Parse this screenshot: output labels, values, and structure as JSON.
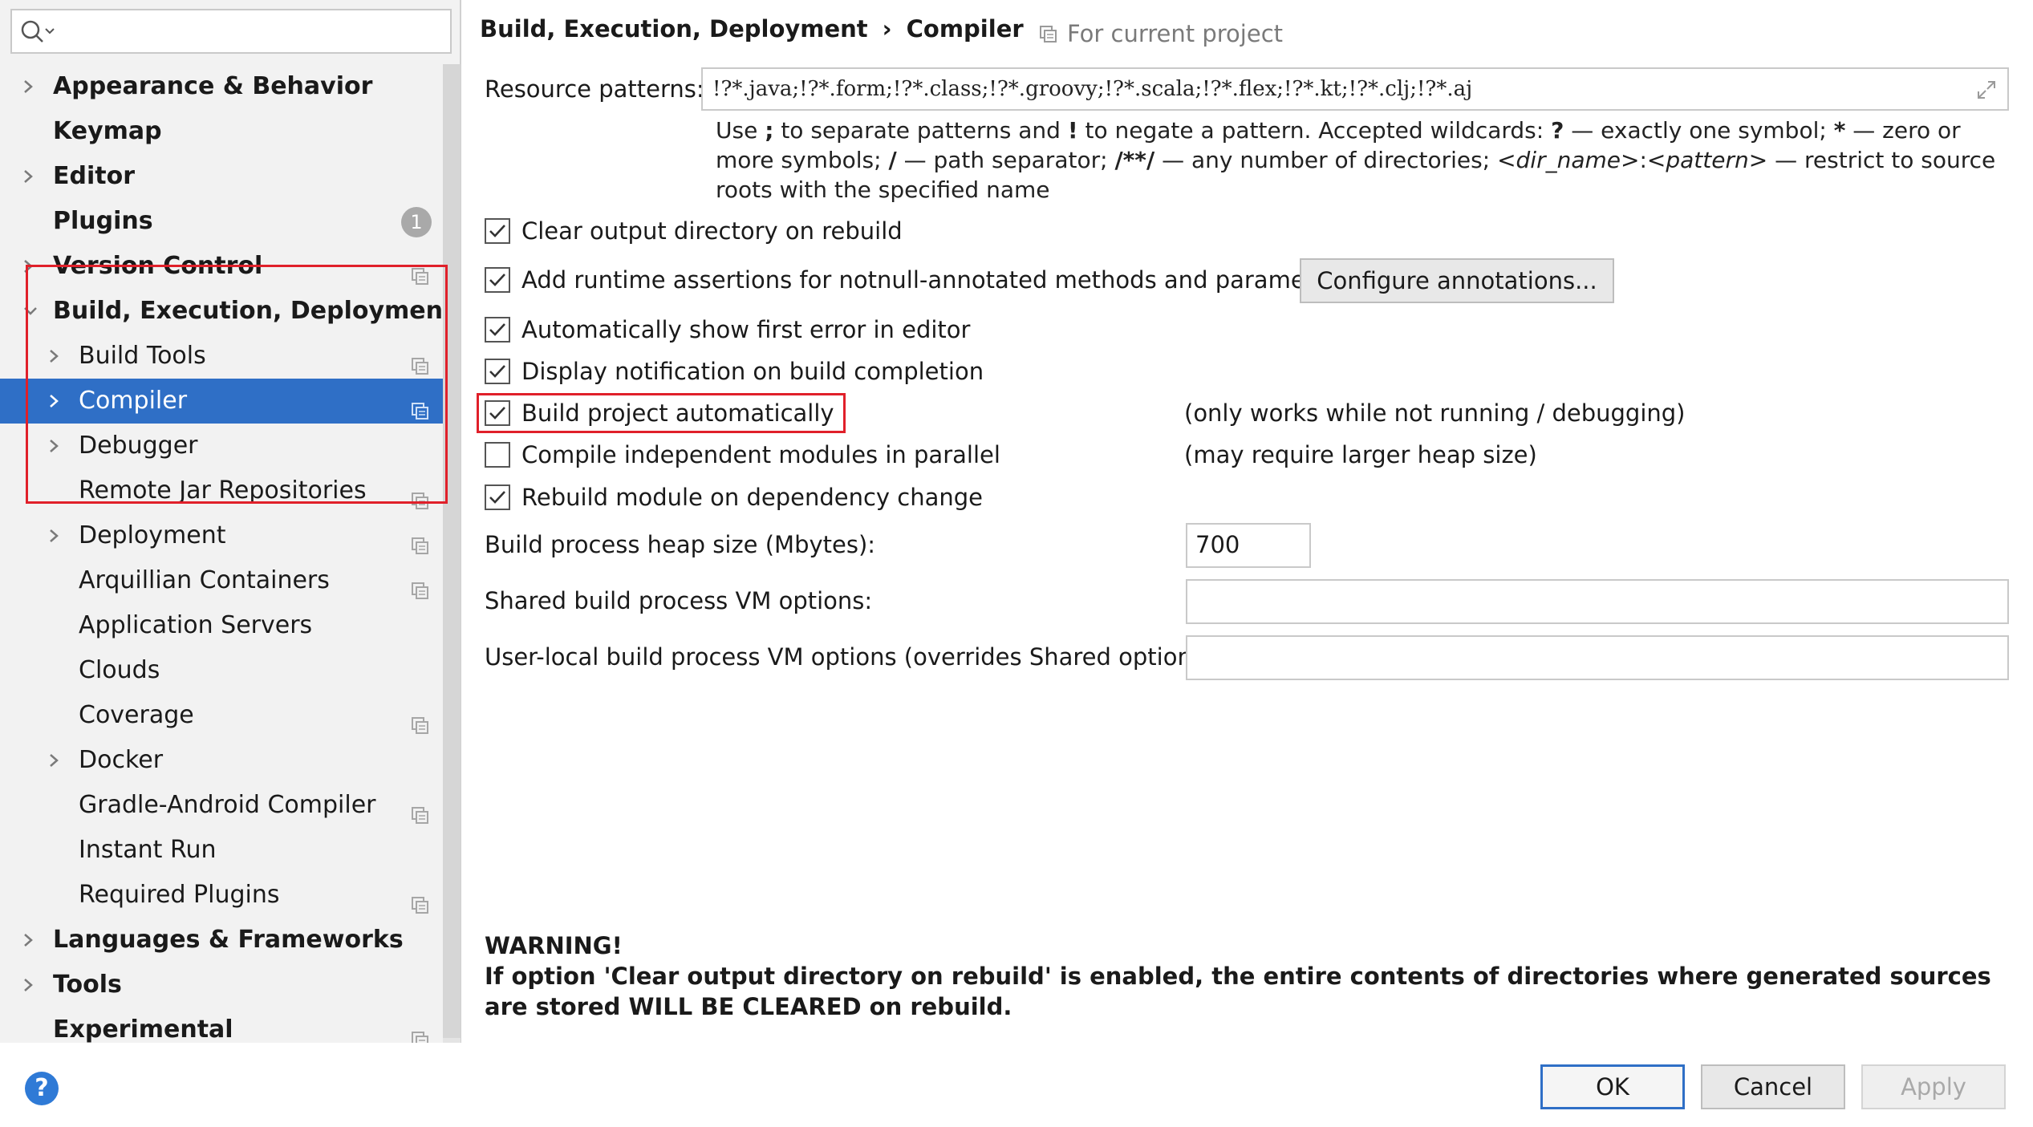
{
  "search": {
    "placeholder": "",
    "value": ""
  },
  "sidebar": {
    "items": [
      {
        "label": "Appearance & Behavior",
        "level": 0,
        "bold": true,
        "chevron": "right",
        "project_icon": false
      },
      {
        "label": "Keymap",
        "level": 0,
        "bold": true,
        "chevron": "none",
        "project_icon": false
      },
      {
        "label": "Editor",
        "level": 0,
        "bold": true,
        "chevron": "right",
        "project_icon": false
      },
      {
        "label": "Plugins",
        "level": 0,
        "bold": true,
        "chevron": "none",
        "badge": "1",
        "project_icon": false
      },
      {
        "label": "Version Control",
        "level": 0,
        "bold": true,
        "chevron": "right",
        "project_icon": true
      },
      {
        "label": "Build, Execution, Deployment",
        "level": 0,
        "bold": true,
        "chevron": "down",
        "project_icon": false
      },
      {
        "label": "Build Tools",
        "level": 1,
        "bold": false,
        "chevron": "right",
        "project_icon": true
      },
      {
        "label": "Compiler",
        "level": 1,
        "bold": false,
        "chevron": "right",
        "project_icon": true,
        "selected": true
      },
      {
        "label": "Debugger",
        "level": 1,
        "bold": false,
        "chevron": "right",
        "project_icon": false
      },
      {
        "label": "Remote Jar Repositories",
        "level": 1,
        "bold": false,
        "chevron": "none",
        "project_icon": true
      },
      {
        "label": "Deployment",
        "level": 1,
        "bold": false,
        "chevron": "right",
        "project_icon": true
      },
      {
        "label": "Arquillian Containers",
        "level": 1,
        "bold": false,
        "chevron": "none",
        "project_icon": true
      },
      {
        "label": "Application Servers",
        "level": 1,
        "bold": false,
        "chevron": "none",
        "project_icon": false
      },
      {
        "label": "Clouds",
        "level": 1,
        "bold": false,
        "chevron": "none",
        "project_icon": false
      },
      {
        "label": "Coverage",
        "level": 1,
        "bold": false,
        "chevron": "none",
        "project_icon": true
      },
      {
        "label": "Docker",
        "level": 1,
        "bold": false,
        "chevron": "right",
        "project_icon": false
      },
      {
        "label": "Gradle-Android Compiler",
        "level": 1,
        "bold": false,
        "chevron": "none",
        "project_icon": true
      },
      {
        "label": "Instant Run",
        "level": 1,
        "bold": false,
        "chevron": "none",
        "project_icon": false
      },
      {
        "label": "Required Plugins",
        "level": 1,
        "bold": false,
        "chevron": "none",
        "project_icon": true
      },
      {
        "label": "Languages & Frameworks",
        "level": 0,
        "bold": true,
        "chevron": "right",
        "project_icon": false
      },
      {
        "label": "Tools",
        "level": 0,
        "bold": true,
        "chevron": "right",
        "project_icon": false
      },
      {
        "label": "Experimental",
        "level": 0,
        "bold": true,
        "chevron": "none",
        "project_icon": true
      }
    ]
  },
  "header": {
    "breadcrumb": [
      "Build, Execution, Deployment",
      "Compiler"
    ],
    "breadcrumb_separator": "›",
    "scope": "For current project"
  },
  "compiler": {
    "resource_patterns_label": "Resource patterns:",
    "resource_patterns_value": "!?*.java;!?*.form;!?*.class;!?*.groovy;!?*.scala;!?*.flex;!?*.kt;!?*.clj;!?*.aj",
    "hint": {
      "t1": "Use ",
      "b1": ";",
      "t2": " to separate patterns and ",
      "b2": "!",
      "t3": " to negate a pattern. Accepted wildcards: ",
      "b3": "?",
      "t4": " — exactly one symbol; ",
      "b4": "*",
      "t5": " — zero or more symbols; ",
      "b5": "/",
      "t6": " — path separator; ",
      "b6": "/**/",
      "t7": " — any number of directories; ",
      "i1": "<dir_name>",
      "t8": ":",
      "i2": "<pattern>",
      "t9": " — restrict to source roots with the specified name"
    },
    "options": [
      {
        "label": "Clear output directory on rebuild",
        "checked": true
      },
      {
        "label": "Add runtime assertions for notnull-annotated methods and parameters",
        "checked": true
      },
      {
        "label": "Automatically show first error in editor",
        "checked": true
      },
      {
        "label": "Display notification on build completion",
        "checked": true
      },
      {
        "label": "Build project automatically",
        "checked": true,
        "note": "(only works while not running / debugging)"
      },
      {
        "label": "Compile independent modules in parallel",
        "checked": false,
        "note": "(may require larger heap size)"
      },
      {
        "label": "Rebuild module on dependency change",
        "checked": true
      }
    ],
    "configure_annotations_label": "Configure annotations...",
    "heap_label": "Build process heap size (Mbytes):",
    "heap_value": "700",
    "shared_vm_label": "Shared build process VM options:",
    "shared_vm_value": "",
    "user_vm_label": "User-local build process VM options (overrides Shared options):",
    "user_vm_value": "",
    "warning_title": "WARNING!",
    "warning_text": "If option 'Clear output directory on rebuild' is enabled, the entire contents of directories where generated sources are stored WILL BE CLEARED on rebuild."
  },
  "footer": {
    "help": "?",
    "ok": "OK",
    "cancel": "Cancel",
    "apply": "Apply"
  },
  "colors": {
    "selection": "#2f6fc6",
    "highlight_box": "#e0202a",
    "sidebar_bg": "#f2f2f2"
  }
}
